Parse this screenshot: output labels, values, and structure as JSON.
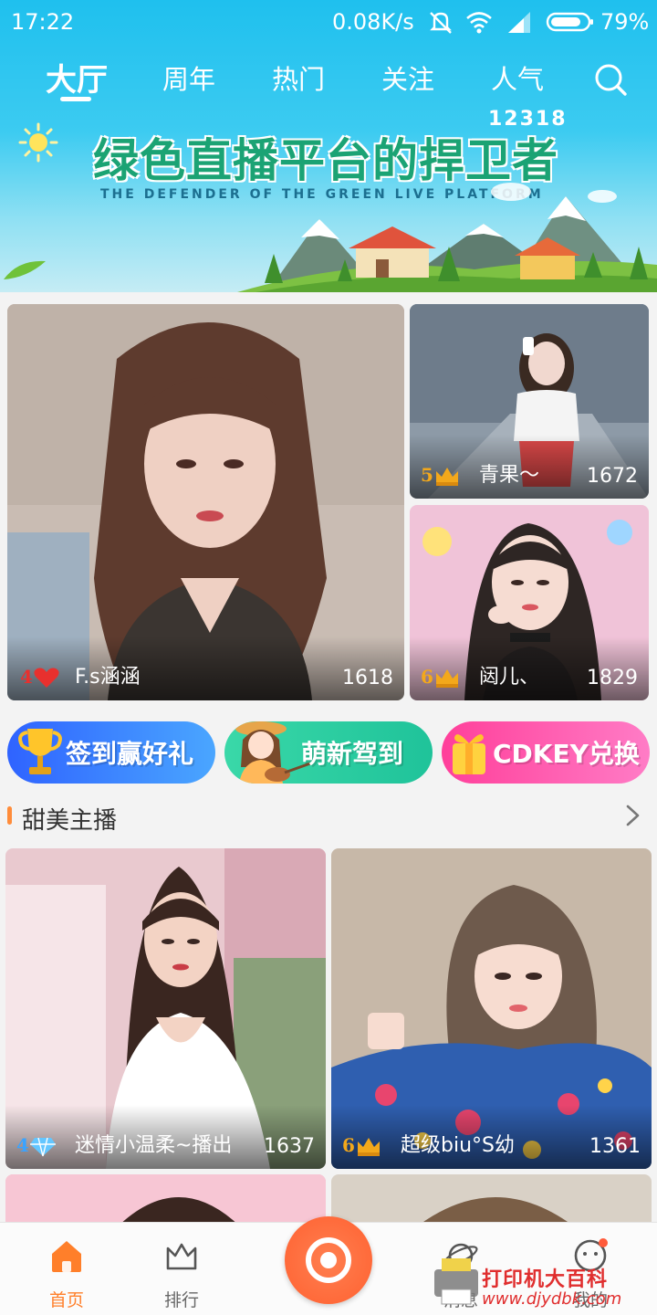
{
  "status_bar": {
    "time": "17:22",
    "network_speed": "0.08K/s",
    "battery_percent": "79%",
    "icons": [
      "mute-icon",
      "wifi-icon",
      "signal-icon",
      "battery-icon"
    ]
  },
  "top_tabs": {
    "items": [
      {
        "label": "大厅",
        "active": true
      },
      {
        "label": "周年",
        "active": false
      },
      {
        "label": "热门",
        "active": false
      },
      {
        "label": "关注",
        "active": false
      },
      {
        "label": "人气",
        "active": false
      }
    ],
    "search_icon": "search-icon"
  },
  "banner": {
    "number": "12318",
    "title": "绿色直播平台的捍卫者",
    "subtitle": "THE DEFENDER OF THE GREEN LIVE PLATFORM"
  },
  "featured": [
    {
      "level": "4",
      "badge_icon": "heart-icon",
      "name": "F.s涵涵",
      "count": "1618"
    },
    {
      "level": "5",
      "badge_icon": "crown-icon",
      "name": "青果～",
      "count": "1672"
    },
    {
      "level": "6",
      "badge_icon": "crown-icon",
      "name": "闼儿、",
      "count": "1829"
    }
  ],
  "promos": [
    {
      "label": "签到赢好礼",
      "icon": "trophy-icon",
      "color": "#3c7dff"
    },
    {
      "label": "萌新驾到",
      "icon": "girl-guitar-icon",
      "color": "#27cfa2"
    },
    {
      "label": "CDKEY兑换",
      "icon": "gift-box-icon",
      "color": "#ff4fa0"
    }
  ],
  "section": {
    "title": "甜美主播",
    "more_icon": "chevron-right-icon"
  },
  "streamers": [
    {
      "level": "4",
      "badge_icon": "diamond-icon",
      "name": "迷情小温柔~播出",
      "count": "1637"
    },
    {
      "level": "6",
      "badge_icon": "crown-icon",
      "name": "超级biu°S幼",
      "count": "1361"
    }
  ],
  "bottom_nav": {
    "items": [
      {
        "label": "首页",
        "icon": "home-icon",
        "active": true
      },
      {
        "label": "排行",
        "icon": "crown-outline-icon",
        "active": false
      },
      {
        "label": "",
        "icon": "live-camera-icon",
        "active": false
      },
      {
        "label": "消息",
        "icon": "planet-icon",
        "active": false
      },
      {
        "label": "我的",
        "icon": "profile-icon",
        "active": false
      }
    ]
  },
  "watermark": {
    "text": "打印机大百科",
    "url": "www.djydbk.com"
  },
  "colors": {
    "accent": "#ff7f2a",
    "header": "#1fc0ee",
    "banner_title": "#1ba374",
    "level_gold": "#f3a81b",
    "level_red": "#e8302e"
  }
}
